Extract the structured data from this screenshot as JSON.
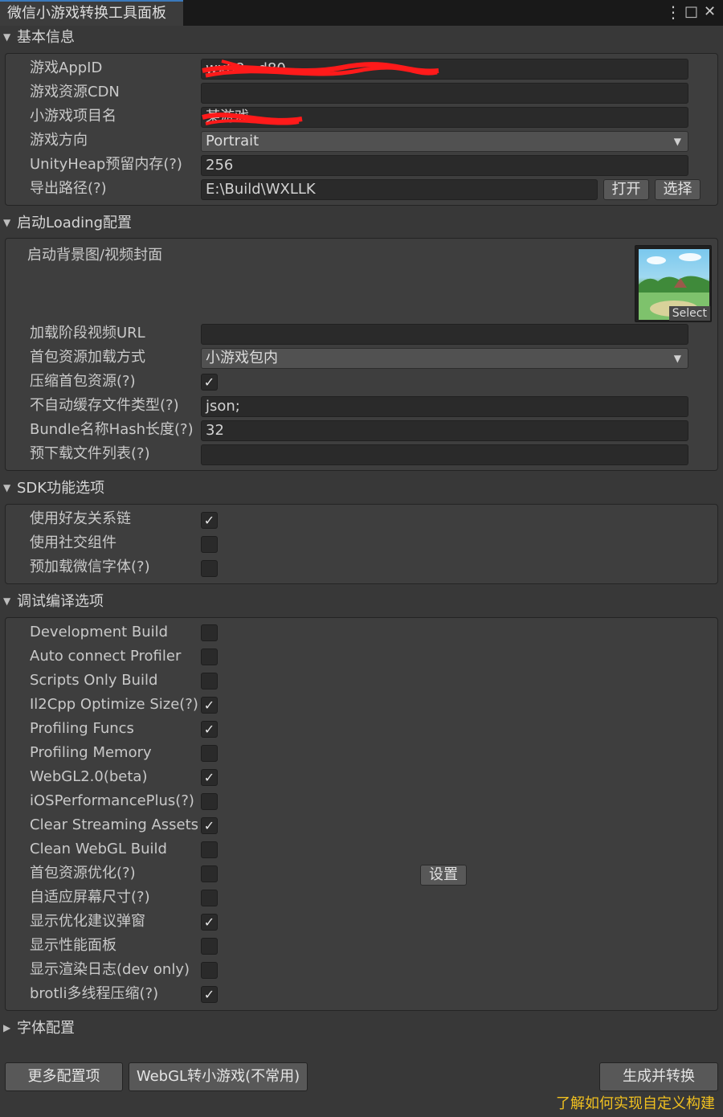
{
  "window": {
    "tab_title": "微信小游戏转换工具面板",
    "menu_icon": "⋮",
    "maximize_icon": "□",
    "close_icon": "✕"
  },
  "basic": {
    "header": "基本信息",
    "appid_label": "游戏AppID",
    "appid_value": "wx68...d80",
    "cdn_label": "游戏资源CDN",
    "cdn_value": "",
    "project_label": "小游戏项目名",
    "project_value": "某游戏",
    "orientation_label": "游戏方向",
    "orientation_value": "Portrait",
    "heap_label": "UnityHeap预留内存(?)",
    "heap_value": "256",
    "export_label": "导出路径(?)",
    "export_value": "E:\\Build\\WXLLK",
    "open_button": "打开",
    "choose_button": "选择"
  },
  "loading": {
    "header": "启动Loading配置",
    "bg_label": "启动背景图/视频封面",
    "select_label": "Select",
    "video_url_label": "加载阶段视频URL",
    "video_url_value": "",
    "load_mode_label": "首包资源加载方式",
    "load_mode_value": "小游戏包内",
    "compress_label": "压缩首包资源(?)",
    "no_cache_label": "不自动缓存文件类型(?)",
    "no_cache_value": "json;",
    "hash_label": "Bundle名称Hash长度(?)",
    "hash_value": "32",
    "preload_label": "预下载文件列表(?)",
    "preload_value": ""
  },
  "sdk": {
    "header": "SDK功能选项",
    "friend_label": "使用好友关系链",
    "social_label": "使用社交组件",
    "font_label": "预加载微信字体(?)"
  },
  "debug": {
    "header": "调试编译选项",
    "items": [
      {
        "label": "Development Build",
        "checked": false
      },
      {
        "label": "Auto connect Profiler",
        "checked": false
      },
      {
        "label": "Scripts Only Build",
        "checked": false
      },
      {
        "label": "Il2Cpp Optimize Size(?)",
        "checked": true
      },
      {
        "label": "Profiling Funcs",
        "checked": true
      },
      {
        "label": "Profiling Memory",
        "checked": false
      },
      {
        "label": "WebGL2.0(beta)",
        "checked": true
      },
      {
        "label": "iOSPerformancePlus(?)",
        "checked": false
      },
      {
        "label": "Clear Streaming Assets",
        "checked": true
      },
      {
        "label": "Clean WebGL Build",
        "checked": false
      },
      {
        "label": "首包资源优化(?)",
        "checked": false
      },
      {
        "label": "自适应屏幕尺寸(?)",
        "checked": false
      },
      {
        "label": "显示优化建议弹窗",
        "checked": true
      },
      {
        "label": "显示性能面板",
        "checked": false
      },
      {
        "label": "显示渲染日志(dev only)",
        "checked": false
      },
      {
        "label": "brotli多线程压缩(?)",
        "checked": true
      }
    ],
    "settings_button": "设置"
  },
  "font_config": {
    "header": "字体配置"
  },
  "footer": {
    "more_button": "更多配置项",
    "webgl_button": "WebGL转小游戏(不常用)",
    "build_button": "生成并转换",
    "help_link": "了解如何实现自定义构建"
  },
  "state": {
    "compress_checked": true,
    "friend_checked": true,
    "social_checked": false,
    "font_checked": false
  },
  "icons": {
    "expanded": "▼",
    "collapsed": "▶",
    "dropdown": "▼",
    "check": "✓"
  }
}
